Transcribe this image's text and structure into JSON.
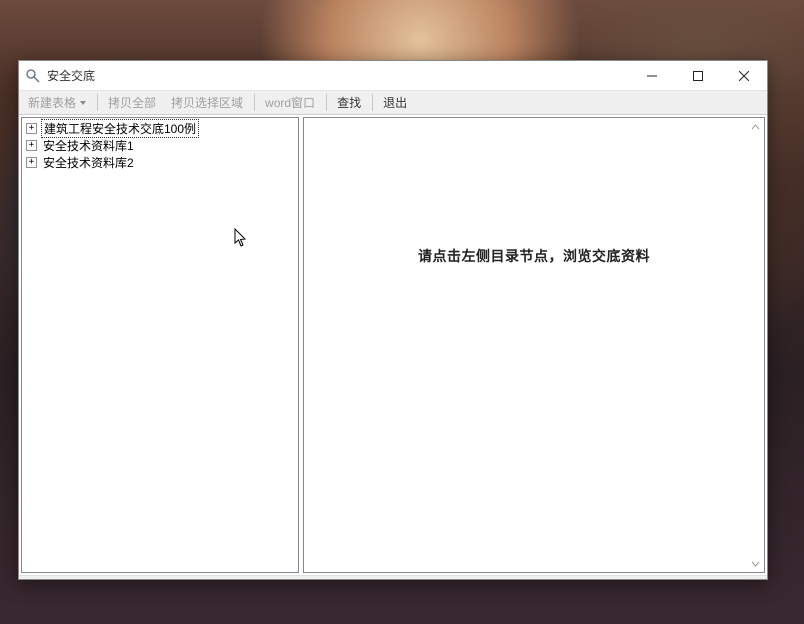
{
  "window": {
    "title": "安全交底"
  },
  "toolbar": {
    "new_table": "新建表格",
    "copy_all": "拷贝全部",
    "copy_selection": "拷贝选择区域",
    "word_window": "word窗口",
    "find": "查找",
    "exit": "退出"
  },
  "tree": {
    "items": [
      {
        "label": "建筑工程安全技术交底100例",
        "selected": true
      },
      {
        "label": "安全技术资料库1",
        "selected": false
      },
      {
        "label": "安全技术资料库2",
        "selected": false
      }
    ]
  },
  "content": {
    "prompt": "请点击左侧目录节点，浏览交底资料"
  },
  "icons": {
    "expand": "+",
    "dropdown": "▾"
  }
}
